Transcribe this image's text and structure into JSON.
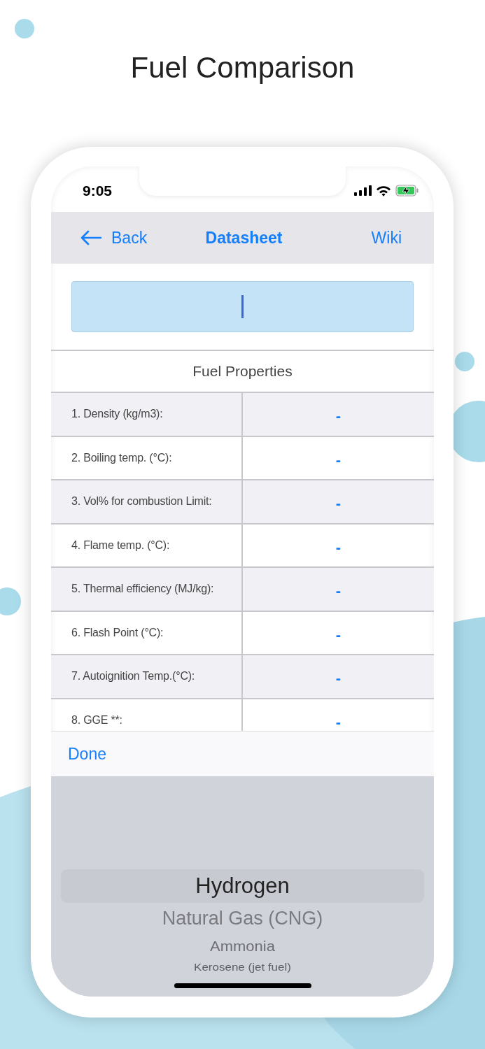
{
  "page_title": "Fuel Comparison",
  "status_bar": {
    "time": "9:05",
    "charging": true
  },
  "nav": {
    "back": "Back",
    "title": "Datasheet",
    "right": "Wiki"
  },
  "search_field": {
    "focused": true
  },
  "table": {
    "title": "Fuel Properties",
    "rows": [
      {
        "label": "1. Density (kg/m3):",
        "value": "-"
      },
      {
        "label": "2. Boiling temp. (°C):",
        "value": "-"
      },
      {
        "label": "3. Vol% for combustion Limit:",
        "value": "-"
      },
      {
        "label": "4. Flame temp. (°C):",
        "value": "-"
      },
      {
        "label": "5. Thermal efficiency (MJ/kg):",
        "value": "-"
      },
      {
        "label": "6. Flash Point (°C):",
        "value": "-"
      },
      {
        "label": "7. Autoignition Temp.(°C):",
        "value": "-"
      },
      {
        "label": "8. GGE **:",
        "value": "-"
      }
    ]
  },
  "toolbar": {
    "done": "Done"
  },
  "picker": {
    "items": [
      {
        "label": "Hydrogen",
        "selected": true
      },
      {
        "label": "Natural Gas (CNG)",
        "selected": false
      },
      {
        "label": "Ammonia",
        "selected": false
      },
      {
        "label": "Kerosene (jet fuel)",
        "selected": false
      }
    ]
  }
}
